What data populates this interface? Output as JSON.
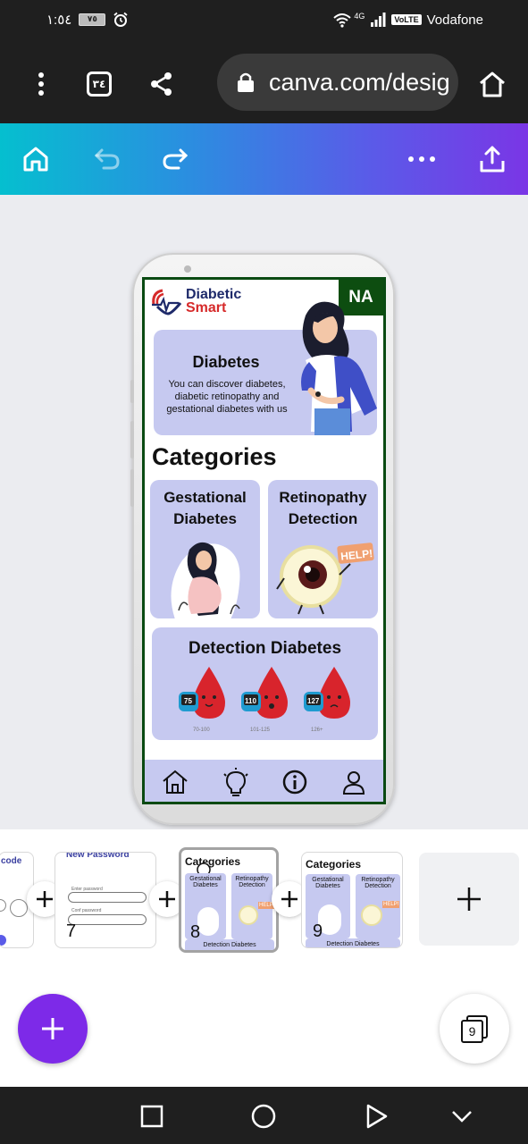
{
  "status_bar": {
    "time": "١:٥٤",
    "battery": "٧٥",
    "network_gen": "4G",
    "volte": "VoLTE",
    "carrier": "Vodafone"
  },
  "browser": {
    "url": "canva.com/desig",
    "tab_count": "٣٤",
    "icons": [
      "more-vert-icon",
      "tabs-icon",
      "share-icon",
      "lock-icon",
      "home-icon"
    ]
  },
  "canva_toolbar": {
    "icons": [
      "home-icon",
      "undo-icon",
      "redo-icon",
      "more-horiz-icon",
      "share-upload-icon"
    ]
  },
  "design": {
    "logo_line1": "Diabetic",
    "logo_line2": "Smart",
    "badge": "NA",
    "hero_title": "Diabetes",
    "hero_text": "You can discover diabetes, diabetic retinopathy and gestational diabetes with us",
    "categories_title": "Categories",
    "card1_title": "Gestational Diabetes",
    "card2_title": "Retinopathy Detection",
    "card2_sign": "HELP!",
    "card3_title": "Detection Diabetes",
    "meters": [
      "75",
      "110",
      "127"
    ],
    "ranges": [
      "70-100",
      "101-125",
      "126+"
    ],
    "nav_icons": [
      "home-icon",
      "lightbulb-icon",
      "info-icon",
      "user-icon"
    ]
  },
  "pages": {
    "thumb_prev_title": "code",
    "thumb7_title": "New Password",
    "thumb7_field1": "Enter password",
    "thumb7_field2": "Conf password",
    "thumb7_num": "7",
    "thumb8_title": "Categories",
    "thumb8_num": "8",
    "thumb9_title": "Categories",
    "thumb9_num": "9",
    "mini_card1": "Gestational Diabetes",
    "mini_card2": "Retinopathy Detection",
    "mini_card3": "Detection Diabetes",
    "mini_sign": "HELP!",
    "page_count": "9"
  }
}
